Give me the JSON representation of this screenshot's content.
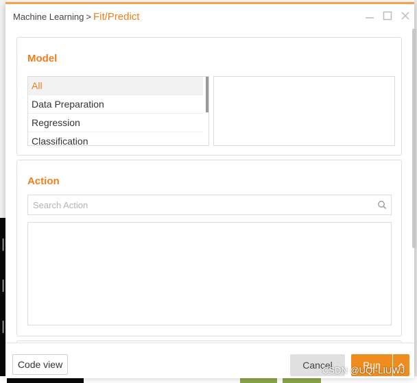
{
  "dialog": {
    "breadcrumb_parent": "Machine Learning",
    "breadcrumb_separator": ">",
    "breadcrumb_current": "Fit/Predict",
    "controls": {
      "minimize_icon": "minimize-icon",
      "maximize_icon": "maximize-icon",
      "close_icon": "close-icon"
    }
  },
  "model": {
    "title": "Model",
    "items": [
      {
        "label": "All",
        "selected": true
      },
      {
        "label": "Data Preparation",
        "selected": false
      },
      {
        "label": "Regression",
        "selected": false
      },
      {
        "label": "Classification",
        "selected": false
      }
    ]
  },
  "action": {
    "title": "Action",
    "search_placeholder": "Search Action",
    "search_value": "",
    "search_icon": "search-icon"
  },
  "footer": {
    "code_view_label": "Code view",
    "cancel_label": "Cancel",
    "run_label": "Run",
    "run_menu_icon": "chevron-up-icon"
  },
  "watermark": "CSDN @UQI-LIUWJ",
  "colors": {
    "accent": "#f07f1a",
    "run_button": "#f08c1e",
    "title_border": "#f5a24a",
    "cancel_button": "#e0e0e0"
  }
}
